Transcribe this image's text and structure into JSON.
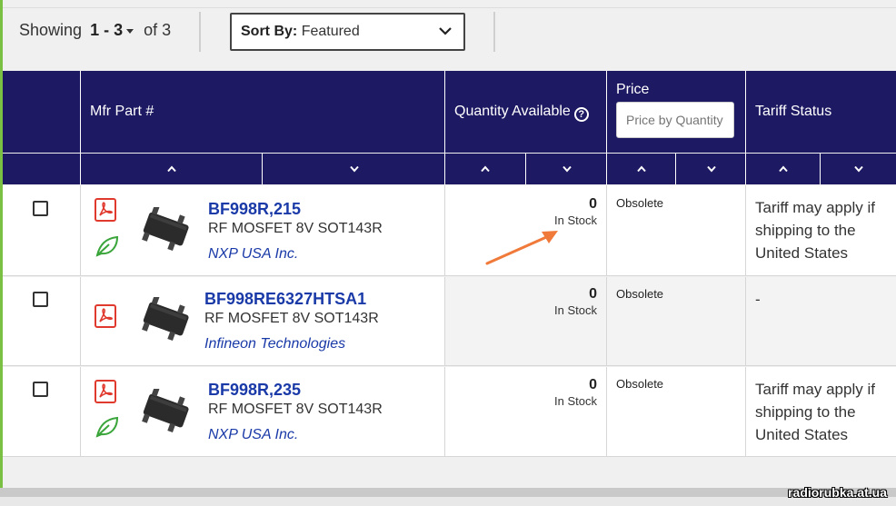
{
  "toolbar": {
    "showing_prefix": "Showing",
    "showing_range": "1 - 3",
    "showing_suffix": "of 3",
    "sort_label": "Sort By:",
    "sort_value": "Featured"
  },
  "headers": {
    "mfr_part": "Mfr Part #",
    "quantity": "Quantity Available",
    "quantity_help": "?",
    "price": "Price",
    "price_placeholder": "Price by Quantity",
    "tariff": "Tariff Status"
  },
  "rows": [
    {
      "part_number": "BF998R,215",
      "description": "RF MOSFET 8V SOT143R",
      "manufacturer": "NXP USA Inc.",
      "quantity": "0",
      "stock_status": "In Stock",
      "price_status": "Obsolete",
      "tariff": "Tariff may apply if shipping to the United States",
      "has_leaf": true
    },
    {
      "part_number": "BF998RE6327HTSA1",
      "description": "RF MOSFET 8V SOT143R",
      "manufacturer": "Infineon Technologies",
      "quantity": "0",
      "stock_status": "In Stock",
      "price_status": "Obsolete",
      "tariff": "-",
      "has_leaf": false
    },
    {
      "part_number": "BF998R,235",
      "description": "RF MOSFET 8V SOT143R",
      "manufacturer": "NXP USA Inc.",
      "quantity": "0",
      "stock_status": "In Stock",
      "price_status": "Obsolete",
      "tariff": "Tariff may apply if shipping to the United States",
      "has_leaf": true
    }
  ],
  "icons": {
    "sort_dropdown": "chevron-down-icon",
    "sort_asc": "chevron-up-icon",
    "sort_desc": "chevron-down-icon",
    "datasheet": "pdf-icon",
    "environmental": "leaf-icon",
    "help": "question-circle-icon"
  },
  "colors": {
    "header_bg": "#1d1962",
    "link": "#1a3aa8",
    "pdf": "#e03a2f",
    "leaf": "#3aa53a",
    "arrow": "#f07a3a",
    "accent": "#7ac143"
  },
  "watermark": "radiorubka.at.ua"
}
